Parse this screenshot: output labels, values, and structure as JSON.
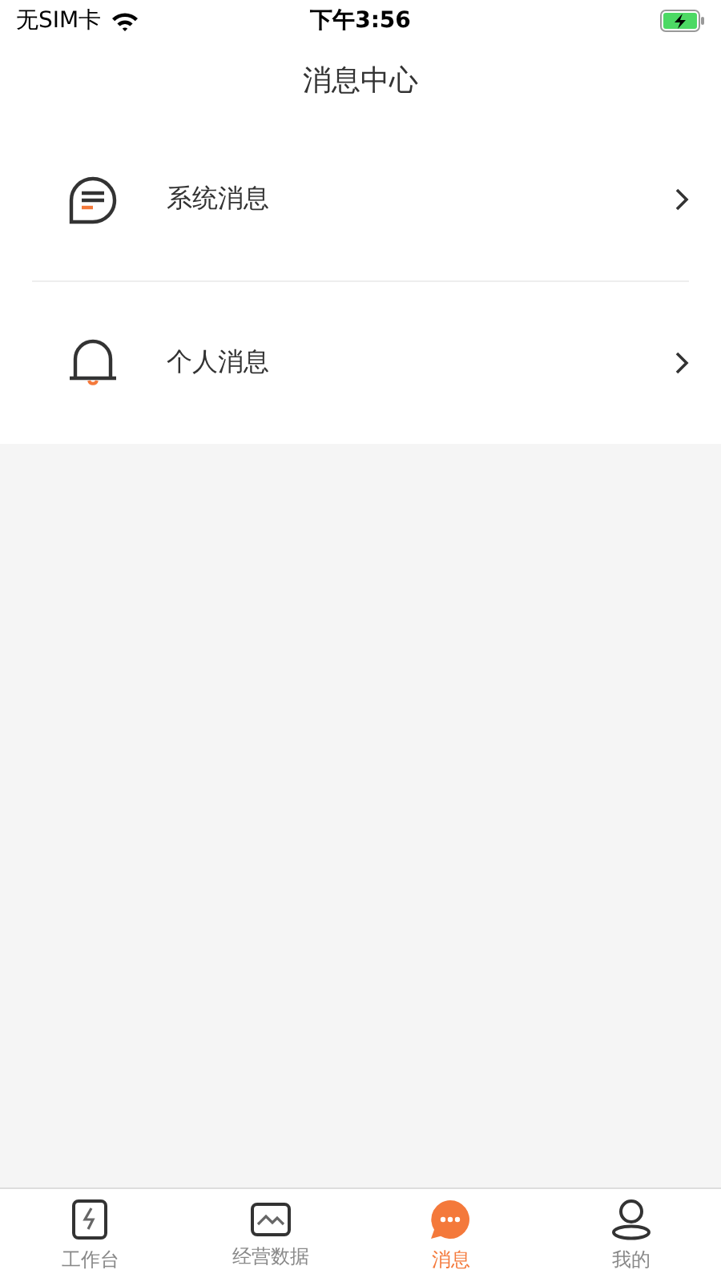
{
  "status_bar": {
    "carrier": "无SIM卡",
    "time": "下午3:56"
  },
  "header": {
    "title": "消息中心"
  },
  "items": [
    {
      "label": "系统消息",
      "kind": "system"
    },
    {
      "label": "个人消息",
      "kind": "personal"
    }
  ],
  "tabs": [
    {
      "label": "工作台",
      "kind": "workbench",
      "selected": false
    },
    {
      "label": "经营数据",
      "kind": "data",
      "selected": false
    },
    {
      "label": "消息",
      "kind": "messages",
      "selected": true
    },
    {
      "label": "我的",
      "kind": "profile",
      "selected": false
    }
  ]
}
